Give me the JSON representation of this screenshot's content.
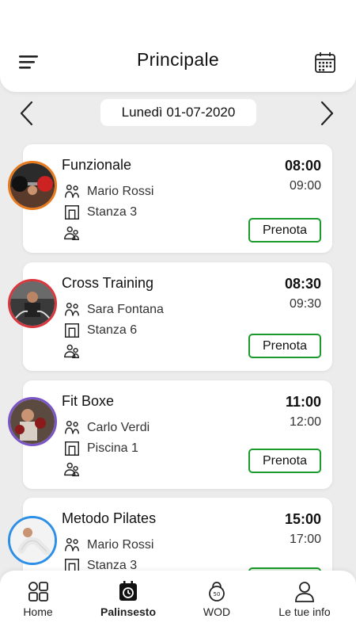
{
  "header": {
    "title": "Principale",
    "menu_icon": "hamburger-menu-icon",
    "calendar_icon": "calendar-icon"
  },
  "date_nav": {
    "date": "Lunedì 01-07-2020",
    "prev_icon": "chevron-left-icon",
    "next_icon": "chevron-right-icon"
  },
  "classes": [
    {
      "name": "Funzionale",
      "instructor": "Mario Rossi",
      "room": "Stanza 3",
      "start": "08:00",
      "end": "09:00",
      "button": "Prenota",
      "ring_color": "#e87a1e"
    },
    {
      "name": "Cross Training",
      "instructor": "Sara Fontana",
      "room": "Stanza 6",
      "start": "08:30",
      "end": "09:30",
      "button": "Prenota",
      "ring_color": "#d9363e"
    },
    {
      "name": "Fit Boxe",
      "instructor": "Carlo Verdi",
      "room": "Piscina 1",
      "start": "11:00",
      "end": "12:00",
      "button": "Prenota",
      "ring_color": "#7a55c7"
    },
    {
      "name": "Metodo Pilates",
      "instructor": "Mario Rossi",
      "room": "Stanza 3",
      "start": "15:00",
      "end": "17:00",
      "button": "",
      "ring_color": "#2d8fe6"
    }
  ],
  "bottom_nav": {
    "items": [
      {
        "label": "Home",
        "icon": "grid-icon"
      },
      {
        "label": "Palinsesto",
        "icon": "schedule-icon",
        "active": true
      },
      {
        "label": "WOD",
        "icon": "kettlebell-icon"
      },
      {
        "label": "Le tue info",
        "icon": "user-icon"
      }
    ]
  },
  "colors": {
    "background": "#ececec",
    "button_border": "#1a9a2a"
  }
}
